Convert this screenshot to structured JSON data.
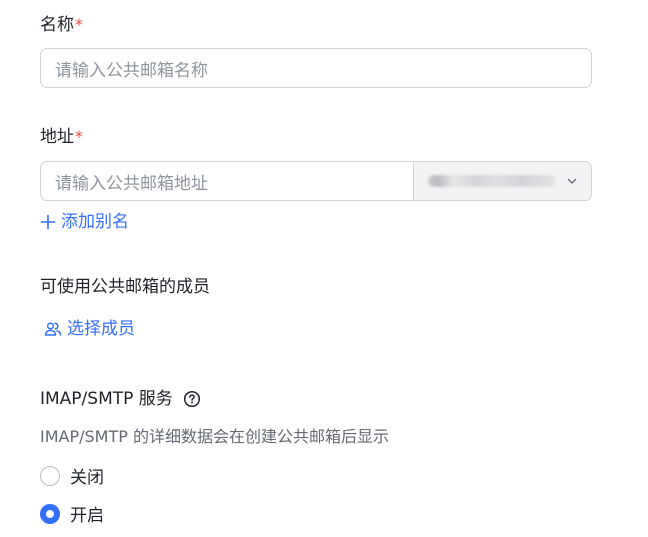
{
  "name_field": {
    "label": "名称",
    "required_mark": "*",
    "placeholder": "请输入公共邮箱名称"
  },
  "address_field": {
    "label": "地址",
    "required_mark": "*",
    "placeholder": "请输入公共邮箱地址",
    "domain_select": {
      "value_obscured": true,
      "icon": "chevron-down-icon"
    }
  },
  "add_alias": {
    "label": "添加别名",
    "icon": "plus-icon"
  },
  "members": {
    "label": "可使用公共邮箱的成员",
    "select_label": "选择成员",
    "icon": "user-group-icon"
  },
  "imap": {
    "label": "IMAP/SMTP 服务",
    "help_icon": "question-circle-icon",
    "description": "IMAP/SMTP 的详细数据会在创建公共邮箱后显示",
    "options": [
      {
        "label": "关闭",
        "selected": false
      },
      {
        "label": "开启",
        "selected": true
      }
    ]
  },
  "colors": {
    "accent": "#3370ff",
    "required": "#f54a45",
    "placeholder": "#8f959e",
    "border": "#d0d3d6"
  }
}
